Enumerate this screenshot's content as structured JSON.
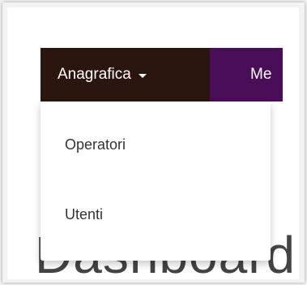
{
  "navbar": {
    "active_menu_label": "Anagrafica",
    "next_menu_label": "Me",
    "colors": {
      "active_bg": "#2a160f",
      "bar_bg": "#4a0d57",
      "text": "#ffffff"
    }
  },
  "dropdown": {
    "items": [
      {
        "label": "Operatori"
      },
      {
        "label": "Utenti"
      }
    ]
  },
  "background": {
    "heading_text": "Dashboard"
  }
}
